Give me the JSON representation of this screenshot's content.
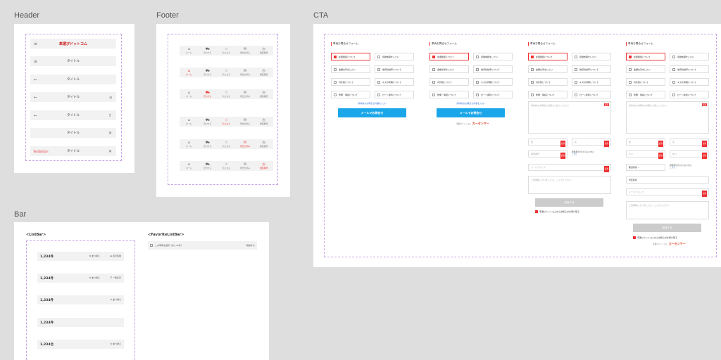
{
  "sections": {
    "header": "Header",
    "footer": "Footer",
    "cta": "CTA",
    "bar": "Bar"
  },
  "header": {
    "logo": "車選びドットコム",
    "title": "タイトル",
    "text_button": "TextButton"
  },
  "footer": {
    "tabs": [
      "ホーム",
      "見つける",
      "気になる",
      "問合せ済み",
      "閲覧履歴"
    ],
    "icons": [
      "home-icon",
      "car-icon",
      "star-icon",
      "mail-icon",
      "clock-icon"
    ]
  },
  "cta": {
    "form_title": "車両お問合せフォーム",
    "options": [
      "在庫確認について",
      "見積依頼をしたい",
      "金額交渉をしたい",
      "他府県納車について",
      "内外装について",
      "キズの有無について",
      "整備・保証について",
      "ローン金利について"
    ],
    "more_link": "具体的なお問合せ内容を入力",
    "mail_button": "メールでお問合せ",
    "brand_label": "車選びドットコム",
    "brand_name": "カーセンサー",
    "textarea_placeholder": "具体的なお問合せ内容をご記入ください",
    "required": "必須",
    "last_name": "姓",
    "first_name": "名",
    "last_kana": "せい",
    "first_kana": "めい",
    "zip": "郵便番号",
    "zip_note": "郵便番号がわからない方は",
    "zip_link": "こちら",
    "prefecture": "都道府県",
    "city": "市区町村",
    "email": "メールアドレス",
    "comment_placeholder": "ご質問等ございましたら、ご入力ください",
    "submit": "送信する",
    "agree": "車選びドットコムからお知らせを受け取る"
  },
  "bar": {
    "listbar_title": "<ListBar>",
    "fav_title": "<FavoriteListBar>",
    "counts": [
      "1,234件",
      "1,234件",
      "1,234件",
      "1,234件",
      "1,234台"
    ],
    "sort": "並べ替え",
    "view1": "表示切替",
    "view2": "一覧表示",
    "fav_select": "この車両を選択（あと10件）",
    "fav_delete": "削除する"
  }
}
